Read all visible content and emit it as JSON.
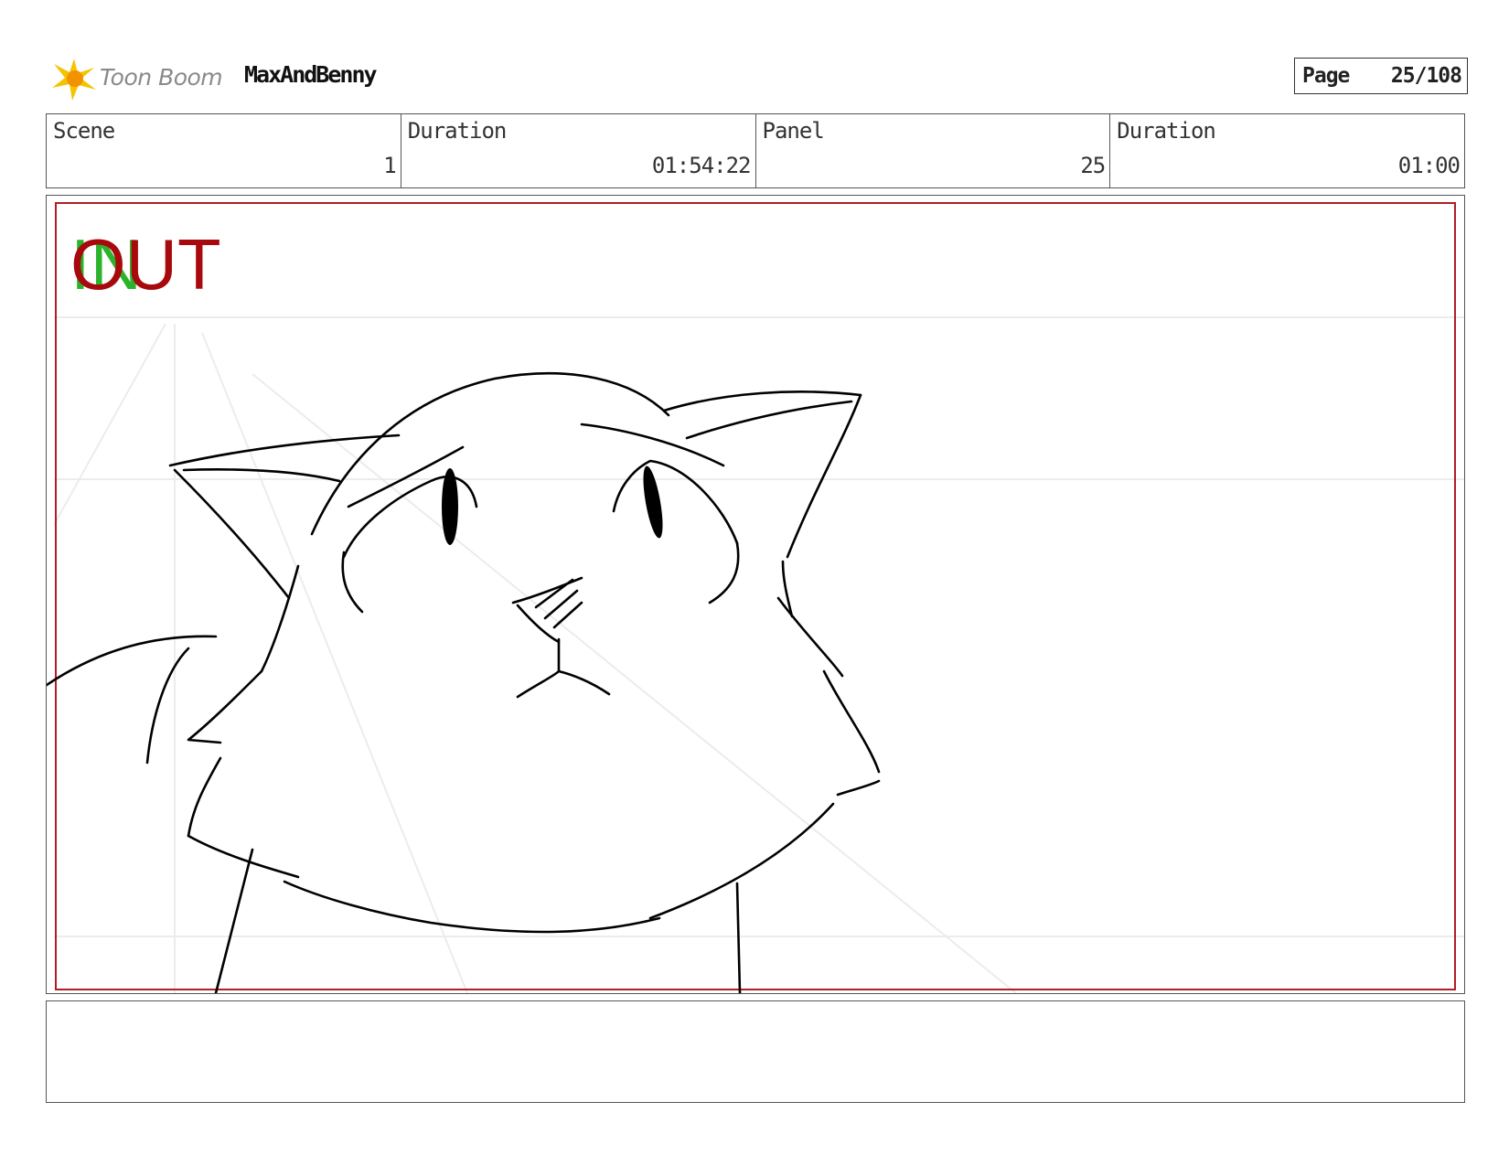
{
  "header": {
    "brand": "Toon Boom",
    "project_title": "MaxAndBenny",
    "page_label": "Page",
    "page_number": "25/108"
  },
  "info": {
    "scene_label": "Scene",
    "scene_value": "1",
    "scene_duration_label": "Duration",
    "scene_duration_value": "01:54:22",
    "panel_label": "Panel",
    "panel_value": "25",
    "panel_duration_label": "Duration",
    "panel_duration_value": "01:00"
  },
  "panel": {
    "in_marker": "IN",
    "out_marker": "OUT"
  },
  "colors": {
    "frame_red": "#b01e23",
    "in_green": "#2bb32b",
    "out_red": "#a8090d",
    "logo_yellow": "#f5c400",
    "logo_orange": "#f39200"
  },
  "caption": {}
}
